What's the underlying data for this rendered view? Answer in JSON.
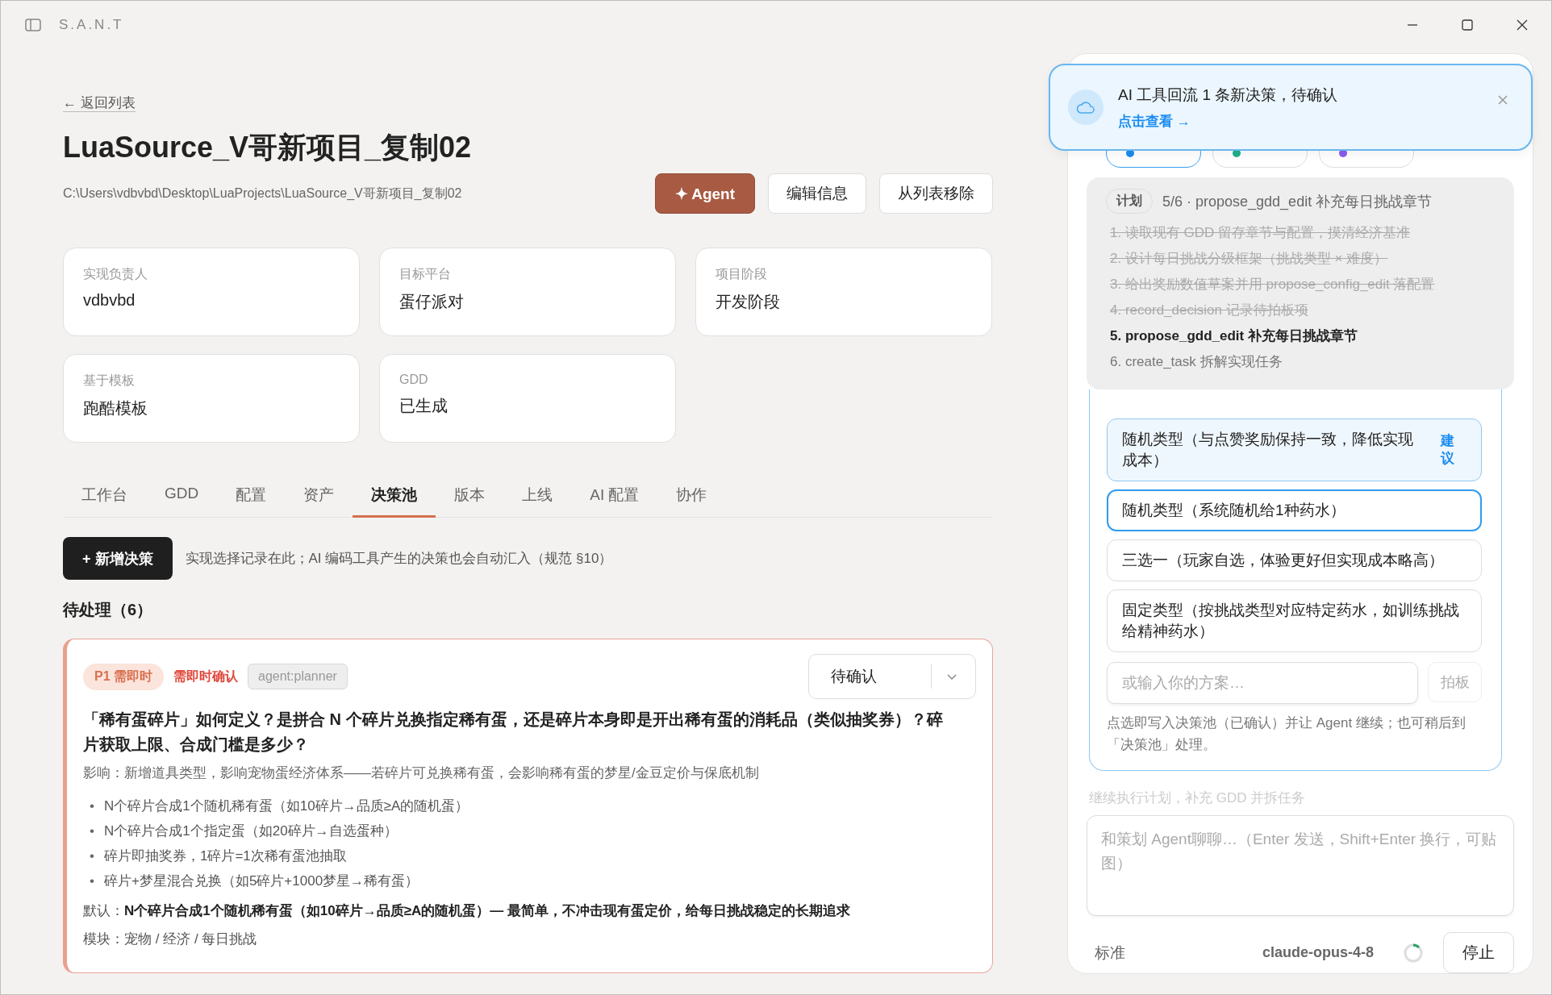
{
  "window": {
    "title": "S.A.N.T"
  },
  "back_link": "← 返回列表",
  "project": {
    "title": "LuaSource_V哥新项目_复制02",
    "path": "C:\\Users\\vdbvbd\\Desktop\\LuaProjects\\LuaSource_V哥新项目_复制02"
  },
  "actions": [
    {
      "label": "✦ Agent",
      "kind": "primary"
    },
    {
      "label": "编辑信息",
      "kind": "secondary"
    },
    {
      "label": "从列表移除",
      "kind": "secondary"
    }
  ],
  "info_cards": [
    {
      "label": "实现负责人",
      "value": "vdbvbd"
    },
    {
      "label": "目标平台",
      "value": "蛋仔派对"
    },
    {
      "label": "项目阶段",
      "value": "开发阶段"
    },
    {
      "label": "基于模板",
      "value": "跑酷模板"
    },
    {
      "label": "GDD",
      "value": "已生成"
    }
  ],
  "tabs": [
    {
      "label": "工作台",
      "selected": false
    },
    {
      "label": "GDD",
      "selected": false
    },
    {
      "label": "配置",
      "selected": false
    },
    {
      "label": "资产",
      "selected": false
    },
    {
      "label": "决策池",
      "selected": true
    },
    {
      "label": "版本",
      "selected": false
    },
    {
      "label": "上线",
      "selected": false
    },
    {
      "label": "AI 配置",
      "selected": false
    },
    {
      "label": "协作",
      "selected": false
    }
  ],
  "toolbar": {
    "new_button": "+ 新增决策",
    "hint": "实现选择记录在此；AI 编码工具产生的决策也会自动汇入（规范 §10）"
  },
  "pending": {
    "heading": "待处理（6）"
  },
  "decision": {
    "priority": "P1 需即时",
    "urgency": "需即时确认",
    "source": "agent:planner",
    "status": "待确认",
    "question": "「稀有蛋碎片」如何定义？是拼合 N 个碎片兑换指定稀有蛋，还是碎片本身即是开出稀有蛋的消耗品（类似抽奖券）？碎片获取上限、合成门槛是多少？",
    "impact": "影响：新增道具类型，影响宠物蛋经济体系——若碎片可兑换稀有蛋，会影响稀有蛋的梦星/金豆定价与保底机制",
    "bullet": "•",
    "options": [
      "N个碎片合成1个随机稀有蛋（如10碎片→品质≥A的随机蛋）",
      "N个碎片合成1个指定蛋（如20碎片→自选蛋种）",
      "碎片即抽奖券，1碎片=1次稀有蛋池抽取",
      "碎片+梦星混合兑换（如5碎片+1000梦星→稀有蛋）"
    ],
    "default": "默认：**N个碎片合成1个随机稀有蛋（如10碎片→品质≥A的随机蛋）— 最简单，不冲击现有蛋定价，给每日挑战稳定的长期追求**",
    "module": "模块：宠物 / 经济 / 每日挑战"
  },
  "agent_panel": {
    "roles": [
      {
        "color": "#1a8cf0",
        "selected": true
      },
      {
        "color": "#1fb08c",
        "selected": false
      },
      {
        "color": "#8a5cf0",
        "selected": false
      }
    ],
    "plan": {
      "tag": "计划",
      "summary": "5/6 · propose_gdd_edit 补充每日挑战章节",
      "steps": [
        {
          "text": "1. 读取现有 GDD 留存章节与配置，摸清经济基准",
          "done": true,
          "current": false
        },
        {
          "text": "2. 设计每日挑战分级框架（挑战类型 × 难度）",
          "done": true,
          "current": false
        },
        {
          "text": "3. 给出奖励数值草案并用 propose_config_edit 落配置",
          "done": true,
          "current": false
        },
        {
          "text": "4. record_decision 记录待拍板项",
          "done": true,
          "current": false
        },
        {
          "text": "5. propose_gdd_edit 补充每日挑战章节",
          "done": false,
          "current": true
        },
        {
          "text": "6. create_task 拆解实现任务",
          "done": false,
          "current": false
        }
      ]
    },
    "choices": [
      {
        "text": "随机类型（与点赞奖励保持一致，降低实现成本）",
        "recommended": true,
        "badge": "建议",
        "selected": false
      },
      {
        "text": "随机类型（系统随机给1种药水）",
        "recommended": false,
        "selected": true
      },
      {
        "text": "三选一（玩家自选，体验更好但实现成本略高）",
        "recommended": false,
        "selected": false
      },
      {
        "text": "固定类型（按挑战类型对应特定药水，如训练挑战给精神药水）",
        "recommended": false,
        "selected": false
      }
    ],
    "custom_input": {
      "placeholder": "或输入你的方案…"
    },
    "submit": "拍板",
    "note": "点选即写入决策池（已确认）并让 Agent 继续；也可稍后到「决策池」处理。",
    "faded_message": "继续执行计划，补充 GDD 并拆任务",
    "chat": {
      "placeholder": "和策划 Agent聊聊…（Enter 发送，Shift+Enter 换行，可贴图）"
    },
    "mode": "标准",
    "model": "claude-opus-4-8",
    "stop": "停止"
  },
  "toast": {
    "message": "AI 工具回流 1 条新决策，待确认",
    "link": "点击查看 →"
  }
}
